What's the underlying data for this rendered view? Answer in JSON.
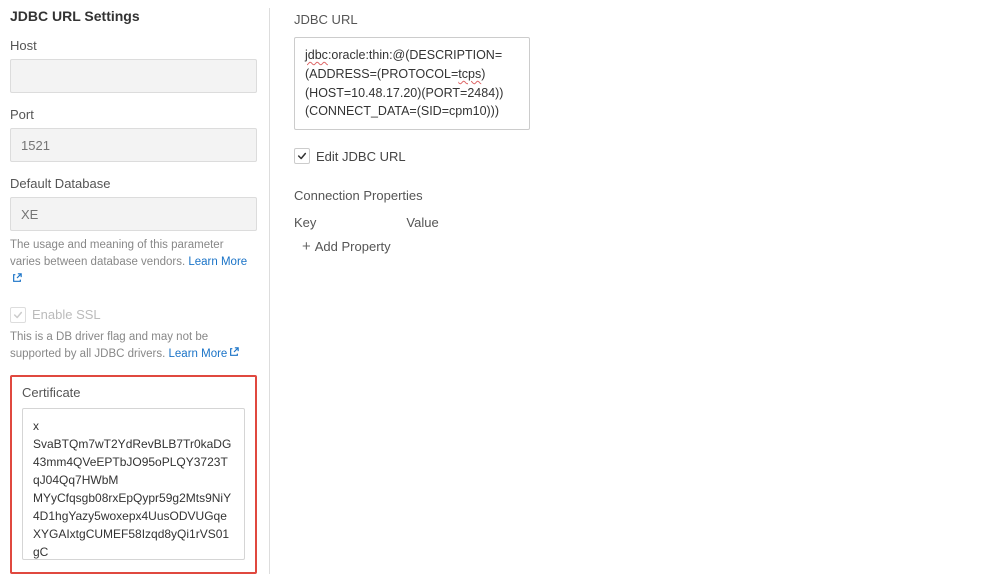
{
  "left": {
    "title": "JDBC URL Settings",
    "hostLabel": "Host",
    "hostValue": "",
    "portLabel": "Port",
    "portPlaceholder": "1521",
    "dbLabel": "Default Database",
    "dbPlaceholder": "XE",
    "dbHelp": "The usage and meaning of this parameter varies between database vendors. ",
    "learnMore": "Learn More",
    "sslLabel": "Enable SSL",
    "sslHelp": "This is a DB driver flag and may not be supported by all JDBC drivers. ",
    "certLabel": "Certificate",
    "certContent": "x\nSvaBTQm7wT2YdRevBLB7Tr0kaDG43mm4QVeEPTbJO95oPLQY3723TqJ04Qq7HWbM\nMYyCfqsgb08rxEpQypr59g2Mts9NiY4D1hgYazy5woxepx4UusODVUGqeXYGAIxtgCUMEF58Izqd8yQi1rVS01gC\n-----END CERTIFICATE-----"
  },
  "right": {
    "urlLabel": "JDBC URL",
    "urlLine1a": "jdbc",
    "urlLine1b": ":oracle:thin:@(DESCRIPTION=",
    "urlLine2a": "(ADDRESS=(PROTOCOL=",
    "urlLine2b": "tcps",
    "urlLine2c": ")",
    "urlLine3": "(HOST=10.48.17.20)(PORT=2484))",
    "urlLine4": "(CONNECT_DATA=(SID=cpm10)))",
    "editLabel": "Edit JDBC URL",
    "connPropsTitle": "Connection Properties",
    "keyHeader": "Key",
    "valueHeader": "Value",
    "addProperty": "Add Property"
  }
}
